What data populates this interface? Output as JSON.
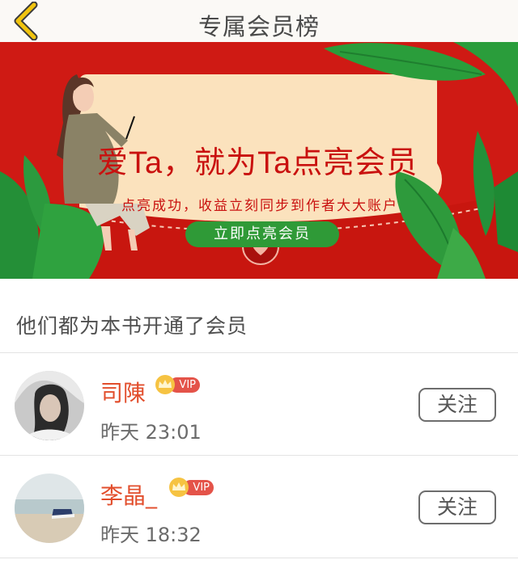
{
  "header": {
    "title": "专属会员榜",
    "back_icon": "chevron-left-icon",
    "back_color": "#f1c40f"
  },
  "banner": {
    "headline": "爱Ta，就为Ta点亮会员",
    "subtitle": "点亮成功，收益立刻同步到作者大大账户",
    "cta_label": "立即点亮会员",
    "background_color": "#cf1a14",
    "cta_color": "#2f9a37"
  },
  "section": {
    "title": "他们都为本书开通了会员"
  },
  "members": [
    {
      "name": "司陳",
      "badge": "VIP",
      "time": "昨天 23:01",
      "follow_label": "关注"
    },
    {
      "name": "李晶_",
      "badge": "VIP",
      "time": "昨天 18:32",
      "follow_label": "关注"
    }
  ]
}
